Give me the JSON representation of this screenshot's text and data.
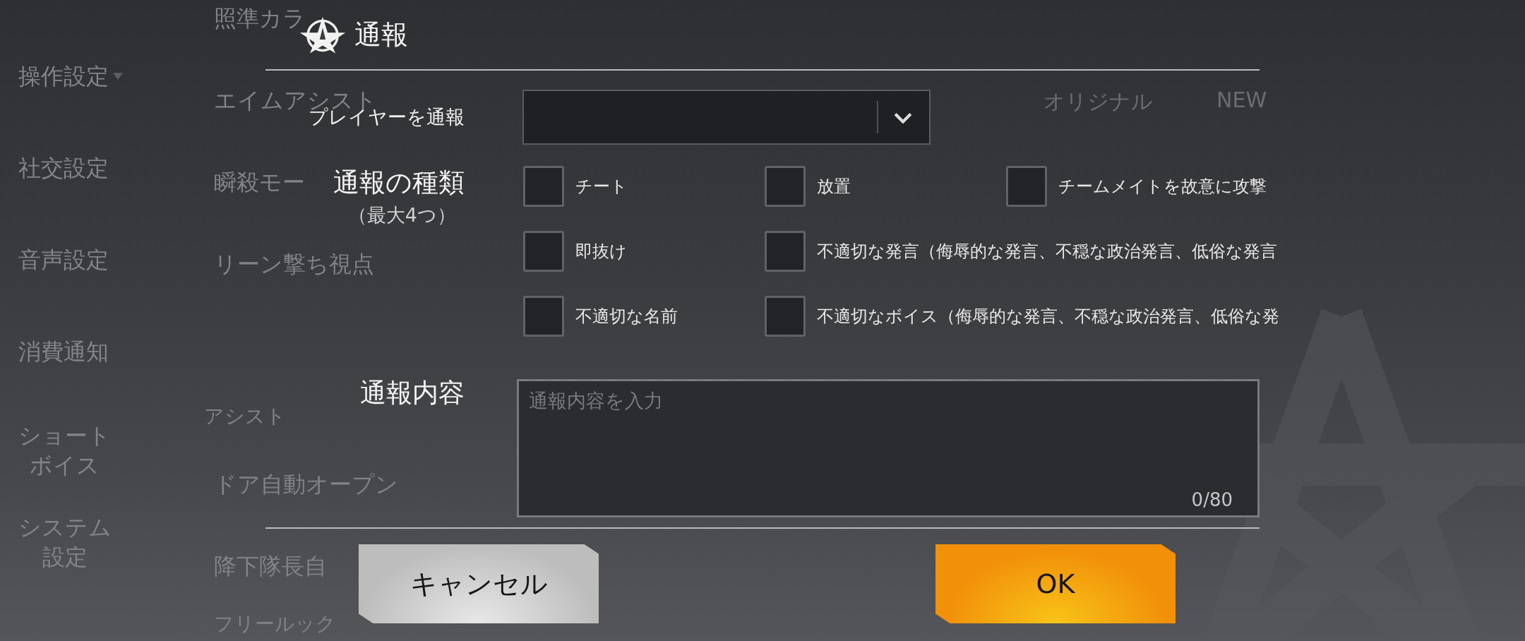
{
  "sidebar": {
    "items": [
      {
        "lines": [
          "操作設定"
        ],
        "has_caret": true
      },
      {
        "lines": [
          "社交設定"
        ],
        "has_caret": false
      },
      {
        "lines": [
          "音声設定"
        ],
        "has_caret": false
      },
      {
        "lines": [
          "消費通知"
        ],
        "has_caret": false
      },
      {
        "lines": [
          "ショート",
          "ボイス"
        ],
        "has_caret": false
      },
      {
        "lines": [
          "システム",
          "設定"
        ],
        "has_caret": false
      }
    ]
  },
  "background_settings": {
    "labels": [
      "照準カラ",
      "エイムアシスト",
      "瞬殺モー",
      "リーン撃ち視点",
      "アシスト",
      "ドア自動オープン",
      "降下隊長自",
      "フリールック"
    ],
    "options": [
      "オリジナル",
      "NEW"
    ]
  },
  "dialog": {
    "title": "通報",
    "player_label": "プレイヤーを通報",
    "types_label": "通報の種類",
    "types_hint": "（最大4つ）",
    "types": [
      {
        "label": "チート",
        "checked": false
      },
      {
        "label": "放置",
        "checked": false
      },
      {
        "label": "チームメイトを故意に攻撃",
        "checked": false
      },
      {
        "label": "即抜け",
        "checked": false
      },
      {
        "label": "不適切な発言（侮辱的な発言、不穏な政治発言、低俗な発言",
        "checked": false
      },
      {
        "label": "不適切な名前",
        "checked": false
      },
      {
        "label": "不適切なボイス（侮辱的な発言、不穏な政治発言、低俗な発",
        "checked": false
      }
    ],
    "content_label": "通報内容",
    "content_placeholder": "通報内容を入力",
    "counter": "0/80",
    "buttons": [
      {
        "label": "キャンセル",
        "kind": "secondary"
      },
      {
        "label": "OK",
        "kind": "primary"
      }
    ]
  }
}
